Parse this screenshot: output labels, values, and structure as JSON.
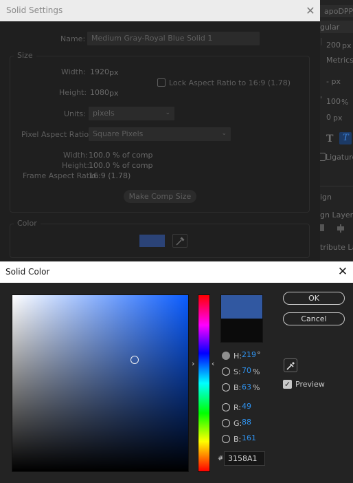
{
  "solid_settings": {
    "title": "Solid Settings",
    "name_label": "Name:",
    "name_value": "Medium Gray-Royal Blue Solid 1",
    "size_group": "Size",
    "width_label": "Width:",
    "width_value": "1920",
    "height_label": "Height:",
    "height_value": "1080",
    "px_unit": "px",
    "lock_aspect_label": "Lock Aspect Ratio to 16:9 (1.78)",
    "units_label": "Units:",
    "units_value": "pixels",
    "par_label": "Pixel Aspect Ratio:",
    "par_value": "Square Pixels",
    "pct_width_label": "Width:",
    "pct_width_value": "100.0 % of comp",
    "pct_height_label": "Height:",
    "pct_height_value": "100.0 % of comp",
    "far_label": "Frame Aspect Ratio:",
    "far_value": "16:9 (1.78)",
    "make_comp_size": "Make Comp Size",
    "color_group": "Color",
    "current_color": "#3158A1"
  },
  "side_panel": {
    "font_name": "apoDPP",
    "font_style": "gular",
    "size_value": "200",
    "px_unit": "px",
    "kerning": "Metrics",
    "tracking_unit": "- px",
    "scale_value": "100",
    "pct_unit": "%",
    "baseline_value": "0",
    "text_t": "T",
    "text_t_italic": "T",
    "ligatures": "Ligature",
    "align_label": "ign",
    "align_layers": "gn Layers",
    "distribute": "tribute La"
  },
  "solid_color": {
    "title": "Solid Color",
    "ok": "OK",
    "cancel": "Cancel",
    "preview": "Preview",
    "h_label": "H:",
    "h_value": "219",
    "h_unit": "°",
    "s_label": "S:",
    "s_value": "70",
    "s_unit": "%",
    "b_label": "B:",
    "b_value": "63",
    "b_unit": "%",
    "r_label": "R:",
    "r_value": "49",
    "g_label": "G:",
    "g_value": "88",
    "bl_label": "B:",
    "bl_value": "161",
    "hex_prefix": "#",
    "hex_value": "3158A1",
    "new_color": "#3158A1",
    "old_color": "#0B0B0B"
  }
}
